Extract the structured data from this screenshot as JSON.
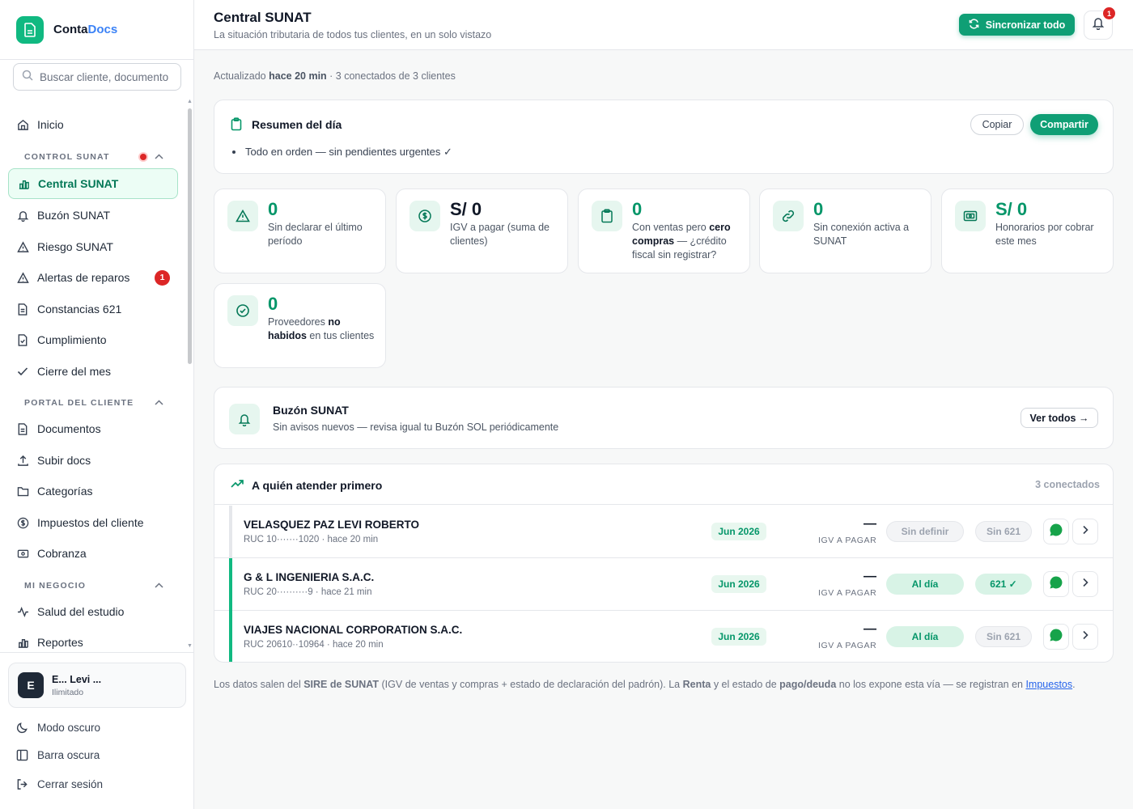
{
  "brand": {
    "name_part1": "Conta",
    "name_part2": "Docs",
    "accent_color": "#3b82f6",
    "logo_color": "#10b981"
  },
  "search": {
    "placeholder": "Buscar cliente, documento..."
  },
  "nav": {
    "inicio": "Inicio",
    "section_control": "CONTROL SUNAT",
    "central": "Central SUNAT",
    "buzon": "Buzón SUNAT",
    "riesgo": "Riesgo SUNAT",
    "alertas": "Alertas de reparos",
    "alertas_badge": "1",
    "constancias": "Constancias 621",
    "cumplimiento": "Cumplimiento",
    "cierre": "Cierre del mes",
    "section_portal": "PORTAL DEL CLIENTE",
    "documentos": "Documentos",
    "subir": "Subir docs",
    "categorias": "Categorías",
    "impuestos": "Impuestos del cliente",
    "cobranza": "Cobranza",
    "section_negocio": "MI NEGOCIO",
    "salud": "Salud del estudio",
    "reportes": "Reportes"
  },
  "user": {
    "initial": "E",
    "name": "E... Levi ...",
    "plan": "Ilimitado"
  },
  "footer_nav": {
    "dark_mode": "Modo oscuro",
    "dark_bar": "Barra oscura",
    "logout": "Cerrar sesión"
  },
  "header": {
    "title": "Central SUNAT",
    "subtitle": "La situación tributaria de todos tus clientes, en un solo vistazo",
    "sync_label": "Sincronizar todo",
    "bell_badge": "1",
    "brand_color": "#0f9f75"
  },
  "status_line": {
    "prefix": "Actualizado",
    "time": "hace 20 min",
    "suffix": "· 3 conectados de 3 clientes"
  },
  "summary": {
    "title": "Resumen del día",
    "item": "Todo en orden — sin pendientes urgentes ✓",
    "copy_label": "Copiar",
    "share_label": "Compartir"
  },
  "stats": [
    {
      "value": "0",
      "label": "Sin declarar el último período",
      "icon": "warning-icon"
    },
    {
      "value": "S/ 0",
      "label": "IGV a pagar (suma de clientes)",
      "icon": "dollar-icon"
    },
    {
      "value": "0",
      "label_a": "Con ventas pero ",
      "label_b": "cero compras",
      "label_c": " — ¿crédito fiscal sin registrar?",
      "icon": "clipboard-icon"
    },
    {
      "value": "0",
      "label": "Sin conexión activa a SUNAT",
      "icon": "link-icon"
    },
    {
      "value": "S/ 0",
      "label": "Honorarios por cobrar este mes",
      "icon": "cash-icon"
    },
    {
      "value": "0",
      "label_a": "Proveedores ",
      "label_b": "no habidos",
      "label_c": " en tus clientes",
      "icon": "check-circle-icon"
    }
  ],
  "buzon": {
    "title": "Buzón SUNAT",
    "subtitle": "Sin avisos nuevos — revisa igual tu Buzón SOL periódicamente",
    "button": "Ver todos →"
  },
  "priority": {
    "title": "A quién atender primero",
    "count": "3 conectados",
    "igv_label": "IGV A PAGAR",
    "rows": [
      {
        "name": "VELASQUEZ PAZ LEVI ROBERTO",
        "meta": "RUC 10·······1020 · hace 20 min",
        "period": "Jun 2026",
        "igv": "—",
        "status": "Sin definir",
        "c621": "Sin 621",
        "status_kind": "neutral",
        "c621_kind": "neutral"
      },
      {
        "name": "G & L INGENIERIA S.A.C.",
        "meta": "RUC 20··········9 · hace 21 min",
        "period": "Jun 2026",
        "igv": "—",
        "status": "Al día",
        "c621": "621 ✓",
        "status_kind": "ok",
        "c621_kind": "ok"
      },
      {
        "name": "VIAJES NACIONAL CORPORATION S.A.C.",
        "meta": "RUC 20610··10964 · hace 20 min",
        "period": "Jun 2026",
        "igv": "—",
        "status": "Al día",
        "c621": "Sin 621",
        "status_kind": "ok",
        "c621_kind": "neutral"
      }
    ]
  },
  "footnote": {
    "t1": "Los datos salen del ",
    "b1": "SIRE de SUNAT",
    "t2": " (IGV de ventas y compras + estado de declaración del padrón). La ",
    "b2": "Renta",
    "t3": " y el estado de ",
    "b3": "pago/deuda",
    "t4": " no los expone esta vía — se registran en ",
    "link": "Impuestos",
    "t5": "."
  }
}
